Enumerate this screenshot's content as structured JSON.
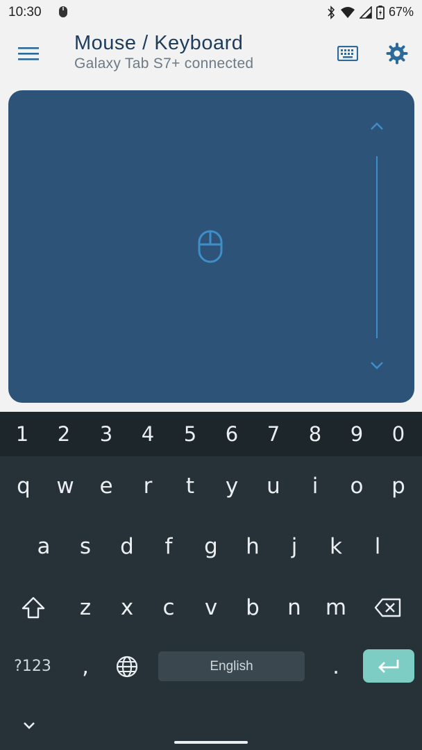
{
  "status_bar": {
    "time": "10:30",
    "battery": "67%"
  },
  "app_bar": {
    "title": "Mouse / Keyboard",
    "subtitle": "Galaxy Tab S7+ connected"
  },
  "colors": {
    "touchpad": "#2d5478",
    "accent": "#3f8ec9",
    "title": "#1d3c5c",
    "keyboard_bg": "#263238",
    "enter_key": "#7ecdc4"
  },
  "keyboard": {
    "number_row": [
      "1",
      "2",
      "3",
      "4",
      "5",
      "6",
      "7",
      "8",
      "9",
      "0"
    ],
    "row1": [
      "q",
      "w",
      "e",
      "r",
      "t",
      "y",
      "u",
      "i",
      "o",
      "p"
    ],
    "row2": [
      "a",
      "s",
      "d",
      "f",
      "g",
      "h",
      "j",
      "k",
      "l"
    ],
    "row3": [
      "z",
      "x",
      "c",
      "v",
      "b",
      "n",
      "m"
    ],
    "symbols_label": "?123",
    "comma": ",",
    "period": ".",
    "space_label": "English"
  }
}
